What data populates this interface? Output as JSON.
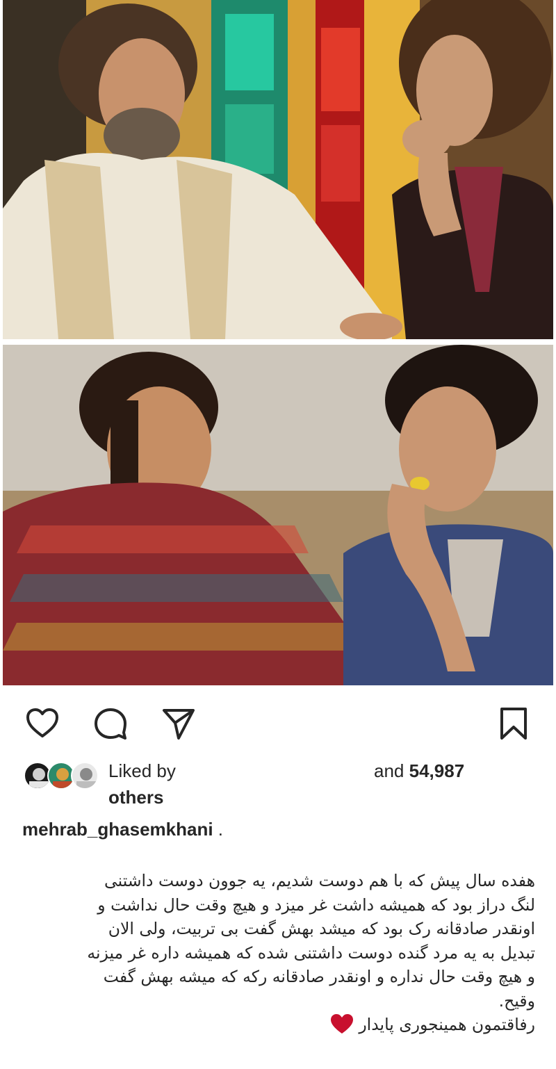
{
  "post": {
    "photo_top_alt": "",
    "photo_bottom_alt": ""
  },
  "actions": {
    "like_icon": "heart-outline-icon",
    "comment_icon": "comment-bubble-icon",
    "share_icon": "paper-plane-icon",
    "save_icon": "bookmark-icon"
  },
  "likes": {
    "prefix": "Liked by",
    "and_label": "and",
    "count": "54,987",
    "others_label": "others"
  },
  "author": {
    "username": "mehrab_ghasemkhani",
    "separator": "."
  },
  "caption": {
    "lines": [
      "هفده سال پیش که با هم دوست شدیم، یه جوون دوست داشتنی",
      "لنگ دراز بود که همیشه داشت غر میزد و هیچ وقت حال نداشت و",
      "اونقدر صادقانه رک بود که میشد بهش گفت بی تربیت، ولی الان",
      "تبدیل به یه مرد گنده دوست داشتنی شده که همیشه داره غر میزنه",
      "و هیچ وقت حال نداره و اونقدر صادقانه رکه که میشه بهش گفت",
      "وقیح.",
      "رفاقتمون همینجوری پایدار"
    ],
    "heart_color": "#c8102e"
  },
  "colors": {
    "text": "#262626",
    "heart": "#c8102e"
  }
}
